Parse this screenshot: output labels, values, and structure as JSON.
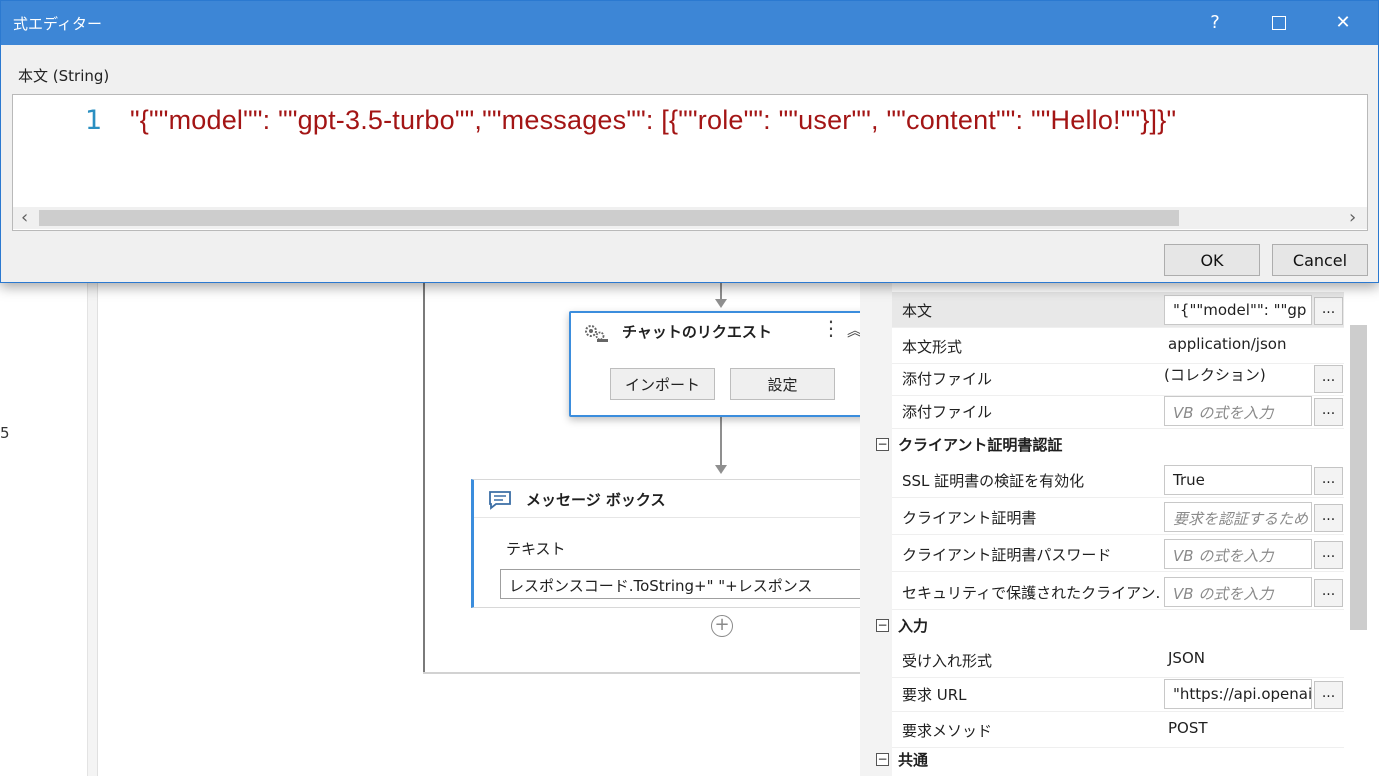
{
  "dialog": {
    "title": "式エディター",
    "help_label": "?",
    "close_label": "✕",
    "field_label": "本文 (String)",
    "line_number": "1",
    "code": "\"{\"\"model\"\": \"\"gpt-3.5-turbo\"\",\"\"messages\"\": [{\"\"role\"\": \"\"user\"\", \"\"content\"\": \"\"Hello!\"\"}]}\"",
    "scroll_left": "‹",
    "scroll_right": "›",
    "ok_label": "OK",
    "cancel_label": "Cancel"
  },
  "left_pane": {
    "fragment": "5"
  },
  "workflow": {
    "chat_request": {
      "title": "チャットのリクエスト",
      "menu_glyph": "⋮",
      "collapse_glyph": "︽",
      "import_label": "インポート",
      "settings_label": "設定"
    },
    "message_box": {
      "title": "メッセージ ボックス",
      "text_label": "テキスト",
      "text_value": "レスポンスコード.ToString+\" \"+レスポンス"
    },
    "add_glyph": "+"
  },
  "properties": {
    "dots_label": "...",
    "rows_top": [
      {
        "name": "本文",
        "value": "\"{\"\"model\"\": \"\"gp",
        "kind": "box"
      },
      {
        "name": "本文形式",
        "value": "application/json",
        "kind": "text"
      },
      {
        "name": "添付ファイル",
        "value": "(コレクション)",
        "kind": "text"
      },
      {
        "name": "添付ファイル",
        "value": "VB の式を入力",
        "kind": "placeholder"
      }
    ],
    "cat_client_cert": "クライアント証明書認証",
    "rows_cert": [
      {
        "name": "SSL 証明書の検証を有効化",
        "value": "True",
        "kind": "box"
      },
      {
        "name": "クライアント証明書",
        "value": "要求を認証するため",
        "kind": "placeholder"
      },
      {
        "name": "クライアント証明書パスワード",
        "value": "VB の式を入力",
        "kind": "placeholder"
      },
      {
        "name": "セキュリティで保護されたクライアン...",
        "value": "VB の式を入力",
        "kind": "placeholder"
      }
    ],
    "cat_input": "入力",
    "rows_input": [
      {
        "name": "受け入れ形式",
        "value": "JSON",
        "kind": "text"
      },
      {
        "name": "要求 URL",
        "value": "\"https://api.openai",
        "kind": "box"
      },
      {
        "name": "要求メソッド",
        "value": "POST",
        "kind": "text"
      }
    ],
    "cat_common": "共通",
    "toggle_glyph": "−"
  }
}
